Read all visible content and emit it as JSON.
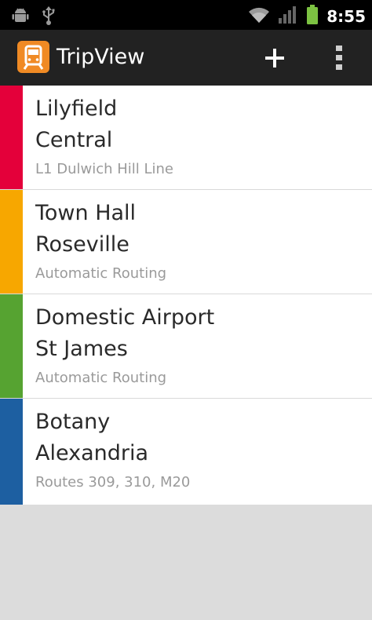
{
  "status_bar": {
    "time": "8:55",
    "icons": [
      "android-icon",
      "usb-icon",
      "wifi-icon",
      "signal-icon",
      "battery-icon"
    ]
  },
  "action_bar": {
    "title": "TripView",
    "background": "#222222",
    "logo_color": "#f08a24",
    "actions": [
      "add-icon",
      "overflow-menu-icon"
    ]
  },
  "trips": [
    {
      "from": "Lilyfield",
      "to": "Central",
      "route": "L1 Dulwich Hill Line",
      "color": "#e4003a"
    },
    {
      "from": "Town Hall",
      "to": "Roseville",
      "route": "Automatic Routing",
      "color": "#f7a700"
    },
    {
      "from": "Domestic Airport",
      "to": "St James",
      "route": "Automatic Routing",
      "color": "#56a331"
    },
    {
      "from": "Botany",
      "to": "Alexandria",
      "route": "Routes 309, 310, M20",
      "color": "#1d5fa1"
    }
  ]
}
